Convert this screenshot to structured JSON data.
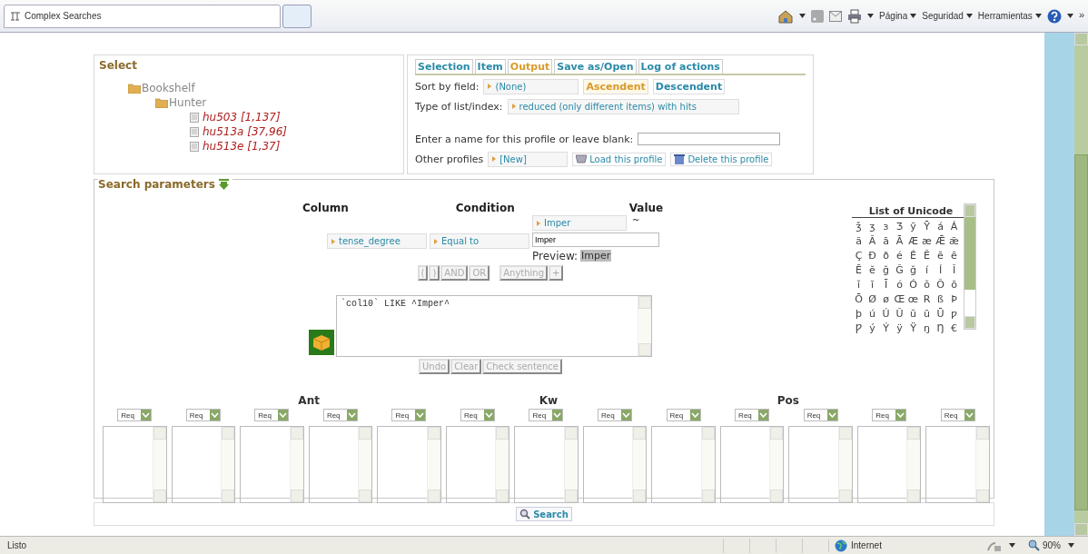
{
  "browser": {
    "tab_title": "Complex Searches",
    "menus": [
      "Página",
      "Seguridad",
      "Herramientas"
    ],
    "more": "»"
  },
  "select": {
    "title": "Select",
    "tree": [
      {
        "label": "Bookshelf",
        "kind": "folder",
        "children": [
          {
            "label": "Hunter",
            "kind": "folder",
            "children": [
              {
                "label": "hu503 [1,137]",
                "kind": "file"
              },
              {
                "label": "hu513a [37,96]",
                "kind": "file"
              },
              {
                "label": "hu513e [1,37]",
                "kind": "file"
              }
            ]
          }
        ]
      }
    ]
  },
  "output_panel": {
    "tabs": [
      {
        "label": "Selection",
        "selected": false
      },
      {
        "label": "Item",
        "selected": false
      },
      {
        "label": "Output",
        "selected": true
      },
      {
        "label": "Save as/Open",
        "selected": false
      },
      {
        "label": "Log of actions",
        "selected": false
      }
    ],
    "sort_by": {
      "label": "Sort by field:",
      "value": "(None)"
    },
    "order": [
      {
        "label": "Ascendent",
        "selected": true
      },
      {
        "label": "Descendent",
        "selected": false
      }
    ],
    "list_type": {
      "label": "Type of list/index:",
      "value": "reduced (only different items) with hits"
    },
    "profile_name": {
      "label": "Enter a name for this profile or leave blank:"
    },
    "other_profiles": {
      "label": "Other profiles",
      "value": "[New]"
    },
    "profile_buttons": [
      {
        "label": "Load this profile",
        "kind": "load"
      },
      {
        "label": "Delete this profile",
        "kind": "delete"
      }
    ]
  },
  "search_parameters": {
    "title": "Search parameters",
    "headers": [
      "Column",
      "Condition",
      "Value"
    ],
    "column": "tense_degree",
    "condition": "Equal to",
    "value_select": "Imper",
    "value_suffix": "~",
    "value_input": "Imper",
    "preview_label": "Preview:",
    "preview": "Imper",
    "operators": [
      "(",
      ")",
      "AND",
      "OR",
      "Anything",
      "+"
    ],
    "sentence": "`col10` LIKE ^Imper^",
    "sentence_buttons": [
      "Undo",
      "Clear",
      "Check sentence"
    ],
    "unicode": {
      "title": "List of Unicode",
      "rows": [
        [
          "ǯ",
          "ʒ",
          "ɜ",
          "Ʒ",
          "ȳ",
          "Ȳ",
          "á",
          "Á"
        ],
        [
          "ă",
          "Ă",
          "ā",
          "Ā",
          "Æ",
          "æ",
          "Ǣ",
          "ǣ"
        ],
        [
          "Ç",
          "Đ",
          "ð",
          "é",
          "É",
          "Ĕ",
          "ĕ",
          "ē"
        ],
        [
          "Ē",
          "ĕ",
          "ğ",
          "Ğ",
          "ğ",
          "í",
          "Í",
          "Ĭ"
        ],
        [
          "ĭ",
          "ī",
          "Ī",
          "ó",
          "Ó",
          "ŏ",
          "Ŏ",
          "ō"
        ],
        [
          "Ō",
          "Ø",
          "ø",
          "Œ",
          "œ",
          "R",
          "ß",
          "Þ"
        ],
        [
          "þ",
          "ú",
          "Ú",
          "Ŭ",
          "ŭ",
          "ū",
          "Ū",
          "ƿ"
        ],
        [
          "Ƿ",
          "ý",
          "Ý",
          "ÿ",
          "Ÿ",
          "ŋ",
          "Ŋ",
          "€"
        ]
      ]
    },
    "groups": [
      "Ant",
      "Kw",
      "Pos"
    ],
    "req_selects": [
      "Req",
      "Req",
      "Req",
      "Req",
      "Req",
      "Req",
      "Req",
      "Req",
      "Req",
      "Req",
      "Req",
      "Req",
      "Req"
    ]
  },
  "search_button": "Search",
  "status_bar": {
    "text": "Listo",
    "zone": "Internet",
    "zoom": "90%"
  }
}
